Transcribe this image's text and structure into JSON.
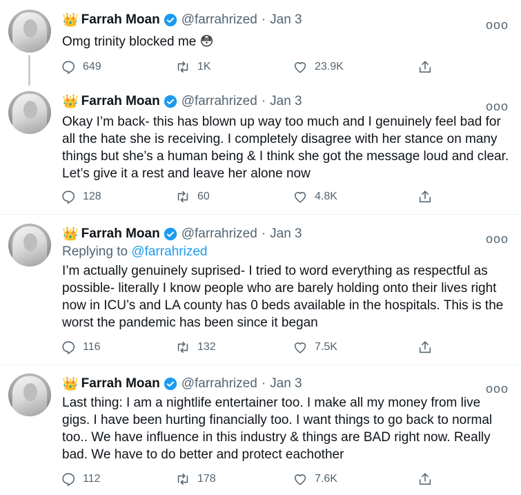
{
  "tweets": [
    {
      "name": "Farrah Moan",
      "handle": "@farrahrized",
      "dot": "·",
      "date": "Jan 3",
      "text": "Omg trinity blocked me 😳",
      "replies": "649",
      "retweets": "1K",
      "likes": "23.9K"
    },
    {
      "name": "Farrah Moan",
      "handle": "@farrahrized",
      "dot": "·",
      "date": "Jan 3",
      "text": "Okay I’m back- this has blown up way too much and I genuinely feel bad for all the hate she is receiving. I completely disagree with her stance on many things but she’s a human being & I think she got the message loud and clear. Let’s give it a rest and leave her alone now",
      "replies": "128",
      "retweets": "60",
      "likes": "4.8K"
    },
    {
      "name": "Farrah Moan",
      "handle": "@farrahrized",
      "dot": "·",
      "date": "Jan 3",
      "replying_prefix": "Replying to",
      "replying_handle": "@farrahrized",
      "text": "I’m actually genuinely suprised- I tried to word everything as respectful as possible- literally I know people who are barely holding onto their lives right now in ICU’s and LA county has 0 beds available in the hospitals. This is the worst the pandemic has been since it began",
      "replies": "116",
      "retweets": "132",
      "likes": "7.5K"
    },
    {
      "name": "Farrah Moan",
      "handle": "@farrahrized",
      "dot": "·",
      "date": "Jan 3",
      "text": "Last thing: I am a nightlife entertainer too. I make all my money from live gigs. I have been hurting financially too. I want things to go back to normal too.. We have influence in this industry & things are BAD right now. Really bad. We have to do better and protect eachother",
      "replies": "112",
      "retweets": "178",
      "likes": "7.6K"
    }
  ],
  "icons": {
    "crown": "👑",
    "verified": "verified-badge-icon",
    "more": "ooo",
    "reply": "reply-icon",
    "retweet": "retweet-icon",
    "like": "heart-icon",
    "share": "share-icon"
  },
  "colors": {
    "accent": "#1d9bf0",
    "secondary_text": "#536471",
    "thread_line": "#c4cfd6",
    "divider": "#eff3f4"
  }
}
